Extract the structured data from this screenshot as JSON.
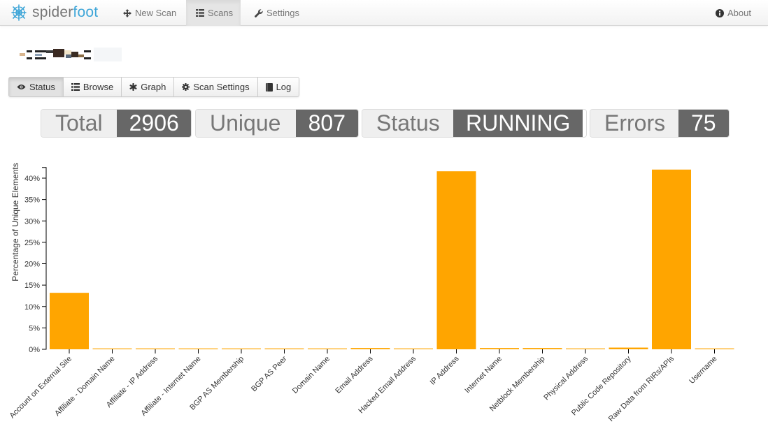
{
  "navbar": {
    "brand": {
      "text_a": "spider",
      "text_b": "foot",
      "logo": "spiderfoot-logo-icon"
    },
    "items": [
      {
        "label": "New Scan",
        "icon": "move-icon",
        "active": false
      },
      {
        "label": "Scans",
        "icon": "list-icon",
        "active": true
      },
      {
        "label": "Settings",
        "icon": "wrench-icon",
        "active": false
      }
    ],
    "about": {
      "label": "About",
      "icon": "info-circle-icon"
    }
  },
  "scan": {
    "name_redacted": true
  },
  "tabs": [
    {
      "label": "Status",
      "icon": "eye-icon",
      "active": true
    },
    {
      "label": "Browse",
      "icon": "list-icon",
      "active": false
    },
    {
      "label": "Graph",
      "icon": "asterisk-icon",
      "active": false
    },
    {
      "label": "Scan Settings",
      "icon": "gear-icon",
      "active": false
    },
    {
      "label": "Log",
      "icon": "book-icon",
      "active": false
    }
  ],
  "stats": {
    "total": {
      "label": "Total",
      "value": "2906"
    },
    "unique": {
      "label": "Unique",
      "value": "807"
    },
    "status": {
      "label": "Status",
      "value": "RUNNING"
    },
    "errors": {
      "label": "Errors",
      "value": "75"
    }
  },
  "colors": {
    "bar": "#FFA500",
    "stat_value_bg": "#676767",
    "stat_label_bg": "#EFEFEF",
    "brand_accent": "#3FA6D8"
  },
  "chart_data": {
    "type": "bar",
    "title": "",
    "xlabel": "",
    "ylabel": "Percentage of Unique Elements",
    "ylim": [
      0,
      42.5
    ],
    "yticks": [
      0,
      5,
      10,
      15,
      20,
      25,
      30,
      35,
      40
    ],
    "ytick_format": "percent",
    "grid": false,
    "categories": [
      "Account on External Site",
      "Affiliate - Domain Name",
      "Affiliate - IP Address",
      "Affiliate - Internet Name",
      "BGP AS Membership",
      "BGP AS Peer",
      "Domain Name",
      "Email Address",
      "Hacked Email Address",
      "IP Address",
      "Internet Name",
      "Netblock Membership",
      "Physical Address",
      "Public Code Repository",
      "Raw Data from RIRs/APIs",
      "Username"
    ],
    "values": [
      13.2,
      0.1,
      0.2,
      0.1,
      0.1,
      0.2,
      0.1,
      0.3,
      0.1,
      41.6,
      0.3,
      0.3,
      0.1,
      0.4,
      42.0,
      0.2
    ]
  }
}
